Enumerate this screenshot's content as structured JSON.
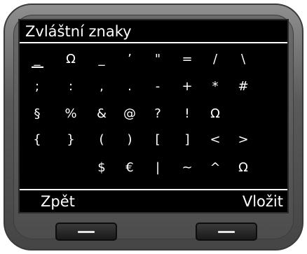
{
  "screen": {
    "title": "Zvláštní znaky",
    "rows": [
      [
        "_",
        "Ω",
        "_",
        "’",
        "\"",
        "=",
        "/",
        "\\"
      ],
      [
        ";",
        ":",
        ",",
        ".",
        "-",
        "+",
        "*",
        "#"
      ],
      [
        "§",
        "%",
        "&",
        "@",
        "?",
        "!",
        "Ω",
        ""
      ],
      [
        "{",
        "}",
        "(",
        ")",
        "[",
        "]",
        "<",
        ">"
      ],
      [
        "",
        "",
        "$",
        "€",
        "|",
        "~",
        "^",
        "Ω"
      ]
    ],
    "selected": {
      "row": 0,
      "col": 0
    },
    "softkeys": {
      "left": "Zpět",
      "right": "Vložit"
    },
    "selection_color": "#f38a2a"
  },
  "hardware": {
    "left_button": "left-softkey",
    "right_button": "right-softkey"
  }
}
